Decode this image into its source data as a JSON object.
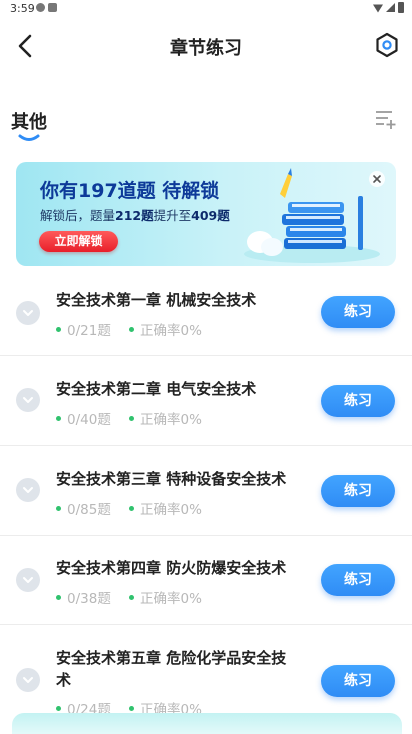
{
  "status_bar": {
    "time": "3:59"
  },
  "header": {
    "title": "章节练习"
  },
  "tabs": [
    {
      "label": "其他"
    }
  ],
  "promo": {
    "title": "你有197道题 待解锁",
    "sub_prefix": "解锁后，题量",
    "sub_from": "212题",
    "sub_mid": "提升至",
    "sub_to": "409题",
    "button_label": "立即解锁"
  },
  "chapters": [
    {
      "title": "安全技术第一章 机械安全技术",
      "progress": "0/21题",
      "accuracy": "正确率0%",
      "button_label": "练习"
    },
    {
      "title": "安全技术第二章 电气安全技术",
      "progress": "0/40题",
      "accuracy": "正确率0%",
      "button_label": "练习"
    },
    {
      "title": "安全技术第三章 特种设备安全技术",
      "progress": "0/85题",
      "accuracy": "正确率0%",
      "button_label": "练习"
    },
    {
      "title": "安全技术第四章 防火防爆安全技术",
      "progress": "0/38题",
      "accuracy": "正确率0%",
      "button_label": "练习"
    },
    {
      "title": "安全技术第五章 危险化学品安全技术",
      "progress": "0/24题",
      "accuracy": "正确率0%",
      "button_label": "练习"
    }
  ],
  "colors": {
    "accent": "#2f8cf5",
    "promo_title": "#0d3a99",
    "unlock_button": "#e81f2a",
    "status_dot": "#30c26e"
  },
  "icons": [
    "back-arrow-icon",
    "hexagon-settings-icon",
    "list-menu-icon",
    "close-icon",
    "chevron-down-icon",
    "books-illustration"
  ]
}
